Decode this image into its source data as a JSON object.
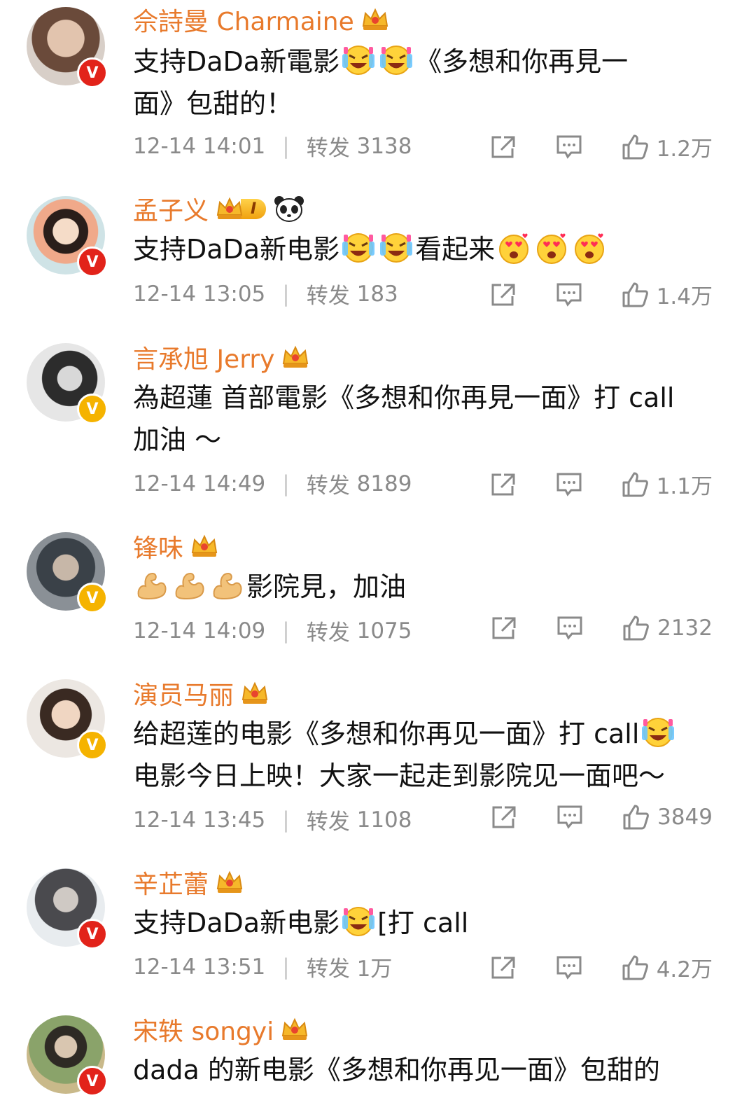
{
  "comments": [
    {
      "name": "佘詩曼 Charmaine",
      "text_a": "支持DaDa新電影",
      "text_b": "《多想和你再見一",
      "text_c": "面》包甜的！",
      "time": "12-14 14:01",
      "repost_label": "转发",
      "repost_count": "3138",
      "likes": "1.2万"
    },
    {
      "name": "孟子义",
      "level_badge": "I",
      "text_a": "支持DaDa新电影",
      "text_b": "看起来",
      "time": "12-14 13:05",
      "repost_label": "转发",
      "repost_count": "183",
      "likes": "1.4万"
    },
    {
      "name": "言承旭 Jerry",
      "text_a": "為超蓮 首部電影《多想和你再見一面》打 call",
      "text_b": "加油 ～",
      "time": "12-14 14:49",
      "repost_label": "转发",
      "repost_count": "8189",
      "likes": "1.1万"
    },
    {
      "name": "锋味",
      "text_a": "影院見，加油",
      "time": "12-14 14:09",
      "repost_label": "转发",
      "repost_count": "1075",
      "likes": "2132"
    },
    {
      "name": "演员马丽",
      "text_a": "给超莲的电影《多想和你再见一面》打 call",
      "text_b": "电影今日上映！大家一起走到影院见一面吧～",
      "time": "12-14 13:45",
      "repost_label": "转发",
      "repost_count": "1108",
      "likes": "3849"
    },
    {
      "name": "辛芷蕾",
      "text_a": "支持DaDa新电影",
      "text_b": "[打 call",
      "time": "12-14 13:51",
      "repost_label": "转发",
      "repost_count": "1万",
      "likes": "4.2万"
    },
    {
      "name": "宋轶 songyi",
      "text_a": "dada 的新电影《多想和你再见一面》包甜的"
    }
  ],
  "verified_mark": "V",
  "colors": {
    "name": "#e87a2c",
    "meta": "#8a8a8a",
    "verified_red": "#e2231a",
    "verified_gold": "#f5b300"
  },
  "icons": [
    "repost-icon",
    "comment-icon",
    "like-icon",
    "crown-icon",
    "laughing-emoji",
    "heart-eyes-emoji",
    "flexed-bicep-emoji",
    "panda-emoji"
  ]
}
